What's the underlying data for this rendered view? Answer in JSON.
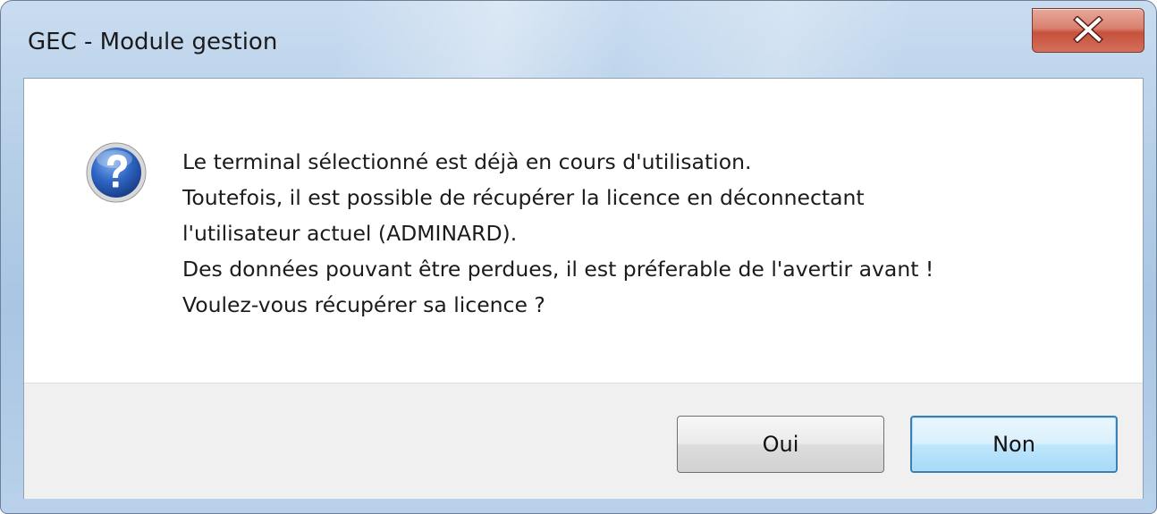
{
  "window": {
    "title": "GEC - Module gestion"
  },
  "titlebar": {
    "close_icon": "close-x-icon"
  },
  "dialog": {
    "icon": "question-icon",
    "message_lines": [
      "Le terminal sélectionné est déjà en cours d'utilisation.",
      "Toutefois, il est possible de récupérer la licence en déconnectant",
      "l'utilisateur actuel (ADMINARD).",
      "Des données pouvant être perdues, il est préferable de l'avertir avant !",
      "Voulez-vous récupérer sa licence ?"
    ]
  },
  "buttons": {
    "yes_label": "Oui",
    "no_label": "Non"
  },
  "colors": {
    "frame": "#b6cfe8",
    "close_button": "#c7513d",
    "default_button_border": "#3c7fb1",
    "icon_blue": "#2b5fb4"
  }
}
